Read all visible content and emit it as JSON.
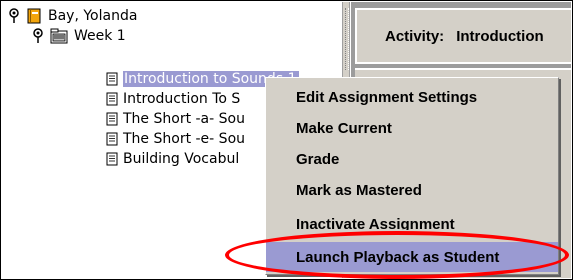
{
  "tree": {
    "student": {
      "name": "Bay, Yolanda",
      "icon": "book-icon",
      "pin_icon": "pushpin-icon"
    },
    "week": {
      "name": "Week 1",
      "icon": "folder-icon",
      "pin_icon": "pushpin-icon"
    },
    "items": [
      {
        "label": "Introduction to Sounds 1",
        "selected": true
      },
      {
        "label": "Introduction To S"
      },
      {
        "label": "The Short -a- Sou"
      },
      {
        "label": "The Short -e- Sou"
      },
      {
        "label": "Building Vocabul"
      }
    ]
  },
  "header": {
    "activity_label": "Activity:",
    "activity_value": "Introduction"
  },
  "context_menu": {
    "items": [
      {
        "label": "Edit Assignment Settings"
      },
      {
        "label": "Make Current"
      },
      {
        "label": "Grade"
      },
      {
        "label": "Mark as Mastered"
      },
      {
        "label": "Inactivate Assignment"
      },
      {
        "label": "Launch Playback as Student",
        "highlighted": true
      }
    ]
  },
  "colors": {
    "selection": "#9a9ad2",
    "menu_bg": "#d4d0c8",
    "annotation": "#ff0000"
  }
}
